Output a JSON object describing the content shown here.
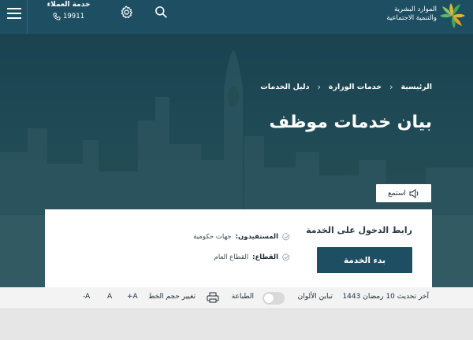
{
  "header": {
    "logo_line1": "الموارد البشرية",
    "logo_line2": "والتنمية الاجتماعية",
    "customer_service_title": "خدمة العملاء",
    "customer_service_phone": "19911",
    "icons": [
      "menu-icon",
      "gear-icon",
      "search-icon",
      "phone-icon"
    ]
  },
  "breadcrumb": {
    "items": [
      "الرئيسية",
      "خدمات الوزارة",
      "دليل الخدمات"
    ],
    "separator": "›"
  },
  "page": {
    "title": "بيان خدمات موظف",
    "listen_label": "استمع"
  },
  "card": {
    "title": "رابط الدخول على الخدمة",
    "start_button": "بدء الخدمة",
    "beneficiaries_label": "المستفيدون:",
    "beneficiaries_value": "جهات حكومية",
    "sector_label": "القطاع:",
    "sector_value": "القطاع العام"
  },
  "footer": {
    "last_update": "آخر تحديث 10 رمضان 1443",
    "contrast_label": "تباين الألوان",
    "print_label": "الطباعة",
    "font_size_label": "تغيير حجم الخط",
    "font_increase": "+A",
    "font_normal": "A",
    "font_decrease": "-A"
  },
  "colors": {
    "header_bg": "#1d4e62",
    "button_bg": "#1d4e62",
    "logo_green": "#3fa65a",
    "logo_gold": "#e5b33a",
    "footer_bg": "#f3f3f3"
  }
}
